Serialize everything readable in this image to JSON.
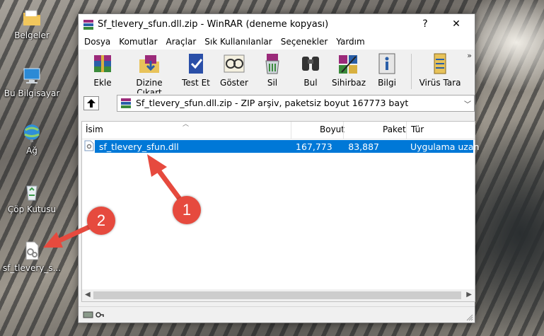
{
  "desktop": {
    "icons": [
      {
        "label": "Belgeler",
        "icon": "folder-documents-icon"
      },
      {
        "label": "Bu Bilgisayar",
        "icon": "computer-icon"
      },
      {
        "label": "Ağ",
        "icon": "network-icon"
      },
      {
        "label": "Çöp Kutusu",
        "icon": "recycle-bin-icon"
      },
      {
        "label": "sf_tlevery_s...",
        "icon": "dll-file-icon"
      }
    ]
  },
  "window": {
    "title": "Sf_tlevery_sfun.dll.zip - WinRAR (deneme kopyası)",
    "help_glyph": "?",
    "close_glyph": "✕",
    "menu": [
      "Dosya",
      "Komutlar",
      "Araçlar",
      "Sık Kullanılanlar",
      "Seçenekler",
      "Yardım"
    ],
    "toolbar": [
      {
        "label": "Ekle",
        "icon": "add-archive-icon"
      },
      {
        "label": "Dizine Çıkart",
        "icon": "extract-to-icon"
      },
      {
        "label": "Test Et",
        "icon": "test-icon"
      },
      {
        "label": "Göster",
        "icon": "view-icon"
      },
      {
        "label": "Sil",
        "icon": "delete-icon"
      },
      {
        "label": "Bul",
        "icon": "find-icon"
      },
      {
        "label": "Sihirbaz",
        "icon": "wizard-icon"
      },
      {
        "label": "Bilgi",
        "icon": "info-icon"
      },
      {
        "label": "Virüs Tara",
        "icon": "virus-scan-icon"
      }
    ],
    "toolbar_overflow": "»",
    "path": "Sf_tlevery_sfun.dll.zip - ZIP arşiv, paketsiz boyut 167773 bayt",
    "columns": [
      "İsim",
      "Boyut",
      "Paket",
      "Tür"
    ],
    "files": [
      {
        "name": "sf_tlevery_sfun.dll",
        "size": "167,773",
        "packed": "83,887",
        "type": "Uygulama uzan"
      }
    ]
  },
  "annotations": {
    "badge1": "1",
    "badge2": "2",
    "color": "#e64a3e"
  }
}
